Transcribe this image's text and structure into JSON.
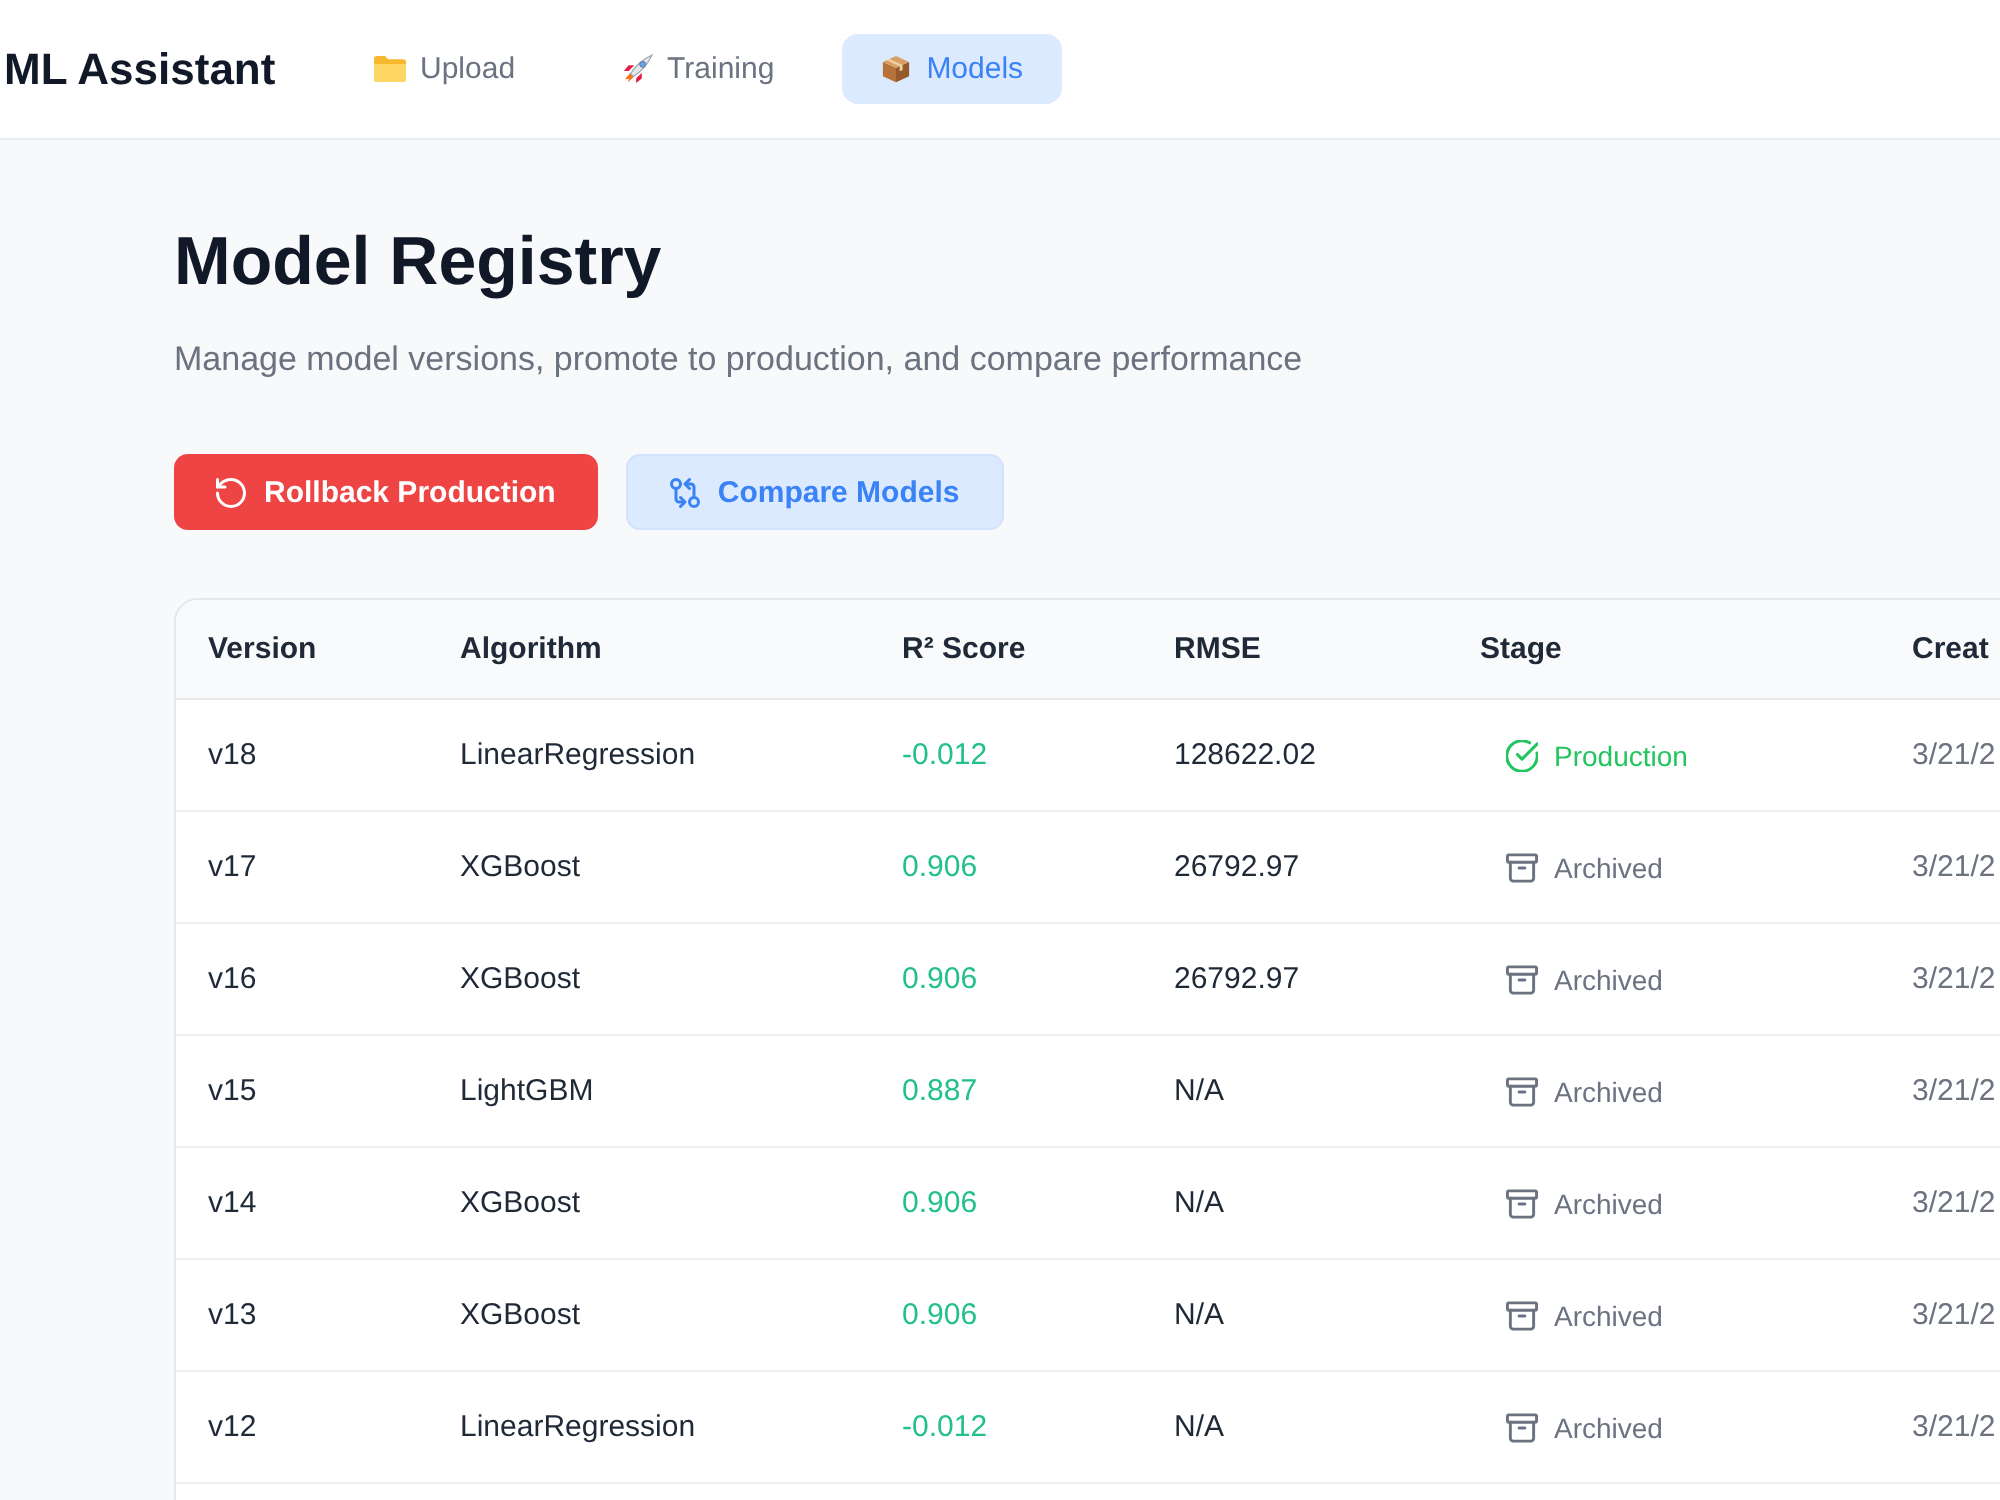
{
  "header": {
    "title": "ML Assistant",
    "tabs": [
      {
        "label": "Upload",
        "selected": false
      },
      {
        "label": "Training",
        "selected": false
      },
      {
        "label": "Models",
        "selected": true
      }
    ]
  },
  "page": {
    "title": "Model Registry",
    "subtitle": "Manage model versions, promote to production, and compare performance",
    "actions": [
      {
        "kind": "danger",
        "label": "Rollback Production"
      },
      {
        "kind": "secondary",
        "label": "Compare Models"
      }
    ]
  },
  "table": {
    "columns": [
      "Version",
      "Algorithm",
      "R² Score",
      "RMSE",
      "Stage",
      "Creat"
    ],
    "rows": [
      {
        "version": "v18",
        "algorithm": "LinearRegression",
        "r2": "-0.012",
        "rmse": "128622.02",
        "stage": {
          "kind": "production",
          "label": "Production"
        },
        "created": "3/21/2"
      },
      {
        "version": "v17",
        "algorithm": "XGBoost",
        "r2": "0.906",
        "rmse": "26792.97",
        "stage": {
          "kind": "archived",
          "label": "Archived"
        },
        "created": "3/21/2"
      },
      {
        "version": "v16",
        "algorithm": "XGBoost",
        "r2": "0.906",
        "rmse": "26792.97",
        "stage": {
          "kind": "archived",
          "label": "Archived"
        },
        "created": "3/21/2"
      },
      {
        "version": "v15",
        "algorithm": "LightGBM",
        "r2": "0.887",
        "rmse": "N/A",
        "stage": {
          "kind": "archived",
          "label": "Archived"
        },
        "created": "3/21/2"
      },
      {
        "version": "v14",
        "algorithm": "XGBoost",
        "r2": "0.906",
        "rmse": "N/A",
        "stage": {
          "kind": "archived",
          "label": "Archived"
        },
        "created": "3/21/2"
      },
      {
        "version": "v13",
        "algorithm": "XGBoost",
        "r2": "0.906",
        "rmse": "N/A",
        "stage": {
          "kind": "archived",
          "label": "Archived"
        },
        "created": "3/21/2"
      },
      {
        "version": "v12",
        "algorithm": "LinearRegression",
        "r2": "-0.012",
        "rmse": "N/A",
        "stage": {
          "kind": "archived",
          "label": "Archived"
        },
        "created": "3/21/2"
      }
    ]
  }
}
